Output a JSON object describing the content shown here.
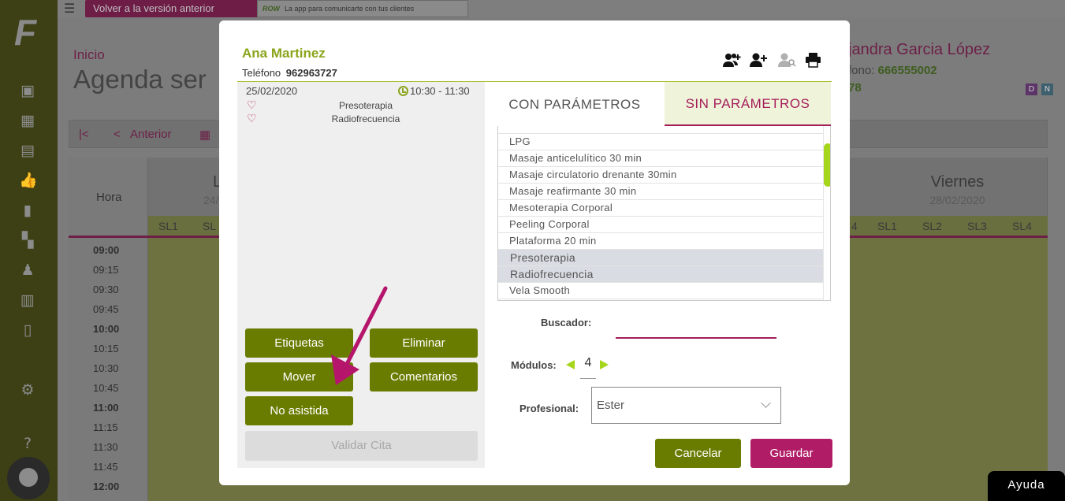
{
  "topbar": {
    "previous_version_label": "Volver a la versión anterior",
    "ad_brand": "ROW",
    "ad_text": "La app para comunicarte con tus clientes"
  },
  "background": {
    "breadcrumb": "Inicio",
    "page_title": "Agenda ser",
    "client_name": "jandra Garcia López",
    "client_phone_label": "fono:",
    "client_phone": "666555002",
    "client_number": "78",
    "badge_d": "D",
    "badge_n": "N",
    "nav_prev": "Anterior",
    "hora_label": "Hora",
    "times": [
      "09:00",
      "09:15",
      "09:30",
      "09:45",
      "10:00",
      "10:15",
      "10:30",
      "10:45",
      "11:00",
      "11:15",
      "11:30",
      "11:45",
      "12:00"
    ],
    "day_left": {
      "name": "L",
      "date": "24/"
    },
    "day_right": {
      "name": "Viernes",
      "date": "28/02/2020"
    },
    "slots_left": [
      "SL1",
      "SL"
    ],
    "slot_partial": "4",
    "slots_right": [
      "SL1",
      "SL2",
      "SL3",
      "SL4"
    ]
  },
  "modal": {
    "client_name": "Ana Martinez",
    "phone_label": "Teléfono",
    "phone": "962963727",
    "appointment": {
      "date": "25/02/2020",
      "time": "10:30 - 11:30",
      "services": [
        "Presoterapia",
        "Radiofrecuencia"
      ]
    },
    "buttons": {
      "etiquetas": "Etiquetas",
      "eliminar": "Eliminar",
      "mover": "Mover",
      "comentarios": "Comentarios",
      "no_asistida": "No asistida",
      "validar_cita": "Validar Cita",
      "cancelar": "Cancelar",
      "guardar": "Guardar"
    },
    "tabs": {
      "con_parametros": "CON PARÁMETROS",
      "sin_parametros": "SIN PARÁMETROS"
    },
    "service_list": [
      {
        "label": "LPG",
        "selected": false
      },
      {
        "label": "Masaje anticelulítico 30 min",
        "selected": false
      },
      {
        "label": "Masaje circulatorio drenante 30min",
        "selected": false
      },
      {
        "label": "Masaje reafirmante 30 min",
        "selected": false
      },
      {
        "label": "Mesoterapia Corporal",
        "selected": false
      },
      {
        "label": "Peeling Corporal",
        "selected": false
      },
      {
        "label": "Plataforma 20 min",
        "selected": false
      },
      {
        "label": "Presoterapia",
        "selected": true
      },
      {
        "label": "Radiofrecuencia",
        "selected": true
      },
      {
        "label": "Vela Smooth",
        "selected": false
      }
    ],
    "buscador_label": "Buscador:",
    "buscador_value": "",
    "modulos_label": "Módulos:",
    "modulos_value": "4",
    "profesional_label": "Profesional:",
    "profesional_value": "Ester"
  },
  "help_button": "Ayuda",
  "colors": {
    "brand_green": "#8aa51c",
    "olive_button": "#6a7c00",
    "magenta": "#b01d66",
    "annotation_arrow": "#b5166c"
  }
}
